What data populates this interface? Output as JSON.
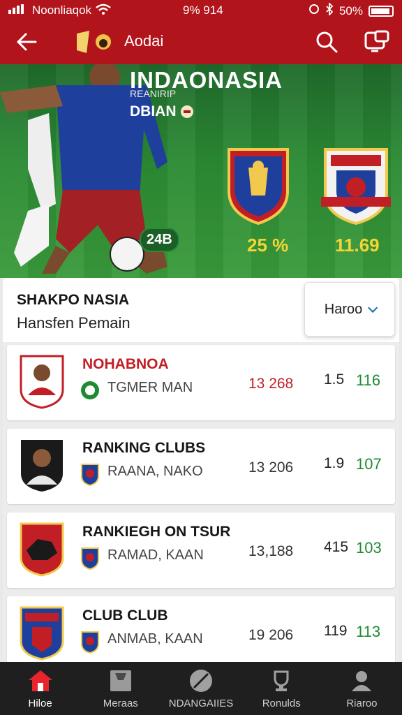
{
  "status_bar": {
    "carrier": "Noonliaqok",
    "center": "9% 914",
    "battery": "50%"
  },
  "app_bar": {
    "title": "Aodai",
    "icons": [
      "back-arrow-icon",
      "search-icon",
      "menu-icon"
    ]
  },
  "hero": {
    "title": "INDAONASIA",
    "subtitle": "REANIRIP",
    "tag": "DBIAN",
    "badge": "24B",
    "stat_left": "25 %",
    "stat_right": "11.69"
  },
  "panel": {
    "title": "SHAKPO NASIA",
    "subtitle": "Hansfen Pemain",
    "filter_label": "Haroo"
  },
  "rows": [
    {
      "name": "NOHABNOA",
      "sub": "TGMER MAN",
      "v1": "13 268",
      "v2": "1.5",
      "v3": "116"
    },
    {
      "name": "RANKING CLUBS",
      "sub": "RAANA, NAKO",
      "v1": "13 206",
      "v2": "1.9",
      "v3": "107"
    },
    {
      "name": "RANKIEGH ON TSUR",
      "sub": "RAMAD, KAAN",
      "v1": "13,188",
      "v2": "415",
      "v3": "103"
    },
    {
      "name": "CLUB CLUB",
      "sub": "ANMAB, KAAN",
      "v1": "19 206",
      "v2": "119",
      "v3": "113"
    }
  ],
  "bottom_nav": [
    {
      "label": "Hiloe",
      "icon": "home-icon"
    },
    {
      "label": "Meraas",
      "icon": "jersey-icon"
    },
    {
      "label": "NDANGAIIES",
      "icon": "ball-icon"
    },
    {
      "label": "Ronulds",
      "icon": "trophy-icon"
    },
    {
      "label": "Riaroo",
      "icon": "profile-icon"
    }
  ],
  "colors": {
    "brand": "#b1141b",
    "accent_green": "#1f8a32",
    "stat_yellow": "#f3d535"
  }
}
